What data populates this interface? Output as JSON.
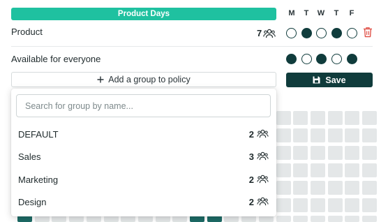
{
  "header": {
    "title": "Product Days",
    "days": [
      "M",
      "T",
      "W",
      "T",
      "F"
    ]
  },
  "product_row": {
    "label": "Product",
    "member_count": "7",
    "member_icon": "people-icon",
    "days_active": [
      false,
      true,
      false,
      true,
      false
    ],
    "delete_icon": "trash-icon"
  },
  "everyone_row": {
    "label": "Available for everyone",
    "days_active": [
      true,
      false,
      true,
      false,
      true
    ]
  },
  "actions": {
    "add_group_icon": "plus-icon",
    "add_group_label": "Add a group to policy",
    "save_icon": "floppy-disk-icon",
    "save_label": "Save"
  },
  "dropdown": {
    "search_placeholder": "Search for group by name...",
    "groups": [
      {
        "name": "DEFAULT",
        "count": "2",
        "icon": "people-icon"
      },
      {
        "name": "Sales",
        "count": "3",
        "icon": "people-icon"
      },
      {
        "name": "Marketing",
        "count": "2",
        "icon": "people-icon"
      },
      {
        "name": "Design",
        "count": "2",
        "icon": "people-icon"
      }
    ]
  },
  "calendar_grid": {
    "bottom_row_highlighted_columns": [
      0,
      10,
      11
    ]
  },
  "colors": {
    "accent_bar": "#1fc1a0",
    "dark_teal": "#103c3c",
    "grid_cell": "#e4e7e8",
    "grid_cell_active": "#1d6b66",
    "delete_red": "#e0534a"
  }
}
